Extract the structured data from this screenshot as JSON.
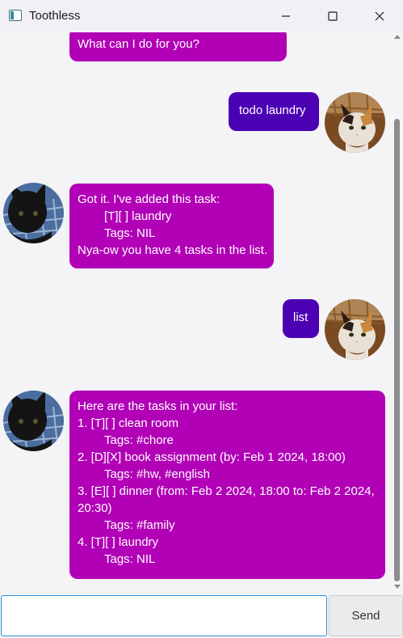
{
  "window": {
    "title": "Toothless",
    "icon": "app-window-icon"
  },
  "chat": {
    "messages": [
      {
        "sender": "bot",
        "lines": [
          "What can I do for you?"
        ]
      },
      {
        "sender": "user",
        "lines": [
          "todo laundry"
        ]
      },
      {
        "sender": "bot",
        "lines": [
          "Got it. I've added this task:",
          "[T][ ] laundry",
          "Tags: NIL",
          "Nya-ow you have 4 tasks in the list."
        ]
      },
      {
        "sender": "user",
        "lines": [
          "list"
        ]
      },
      {
        "sender": "bot",
        "lines": [
          "Here are the tasks in your list:",
          "1. [T][ ] clean room",
          "Tags: #chore",
          "2. [D][X] book assignment (by: Feb 1 2024, 18:00)",
          "Tags: #hw, #english",
          "3. [E][ ] dinner (from: Feb 2 2024, 18:00 to: Feb 2 2024,",
          "20:30)",
          "Tags: #family",
          "4. [T][ ] laundry",
          "Tags: NIL"
        ]
      }
    ]
  },
  "input": {
    "value": "",
    "placeholder": ""
  },
  "send_button": {
    "label": "Send"
  },
  "colors": {
    "bot_bubble": "#b100b6",
    "user_bubble": "#4c00b3",
    "input_focus": "#2b96d9"
  }
}
